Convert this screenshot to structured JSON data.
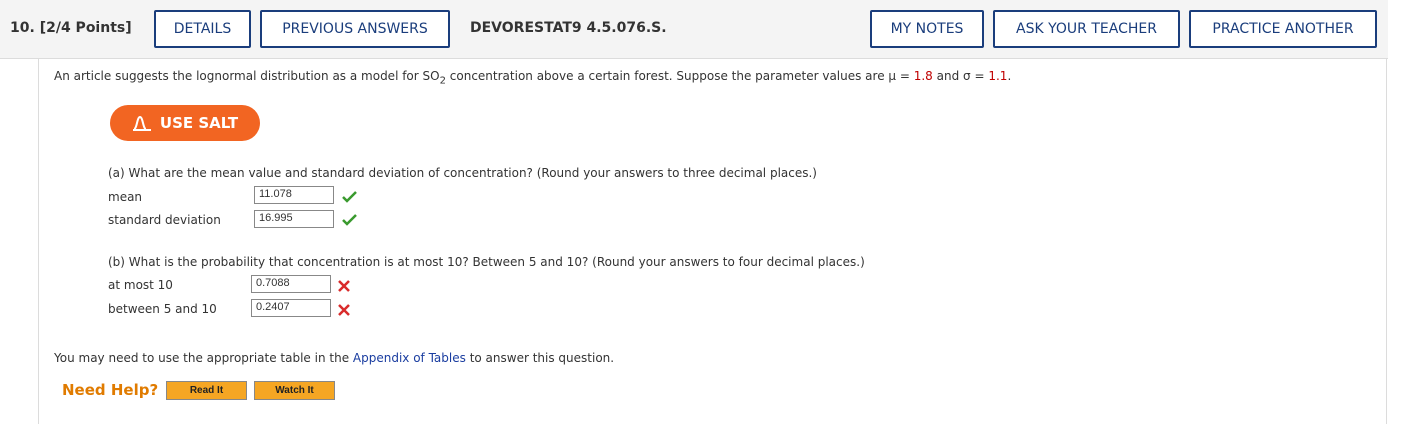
{
  "header": {
    "question_number": "10.",
    "points": "[2/4 Points]",
    "details_label": "DETAILS",
    "previous_answers_label": "PREVIOUS ANSWERS",
    "problem_code": "DEVORESTAT9 4.5.076.S.",
    "my_notes_label": "MY NOTES",
    "ask_teacher_label": "ASK YOUR TEACHER",
    "practice_another_label": "PRACTICE ANOTHER"
  },
  "problem": {
    "intro_before": "An article suggests the lognormal distribution as a model for SO",
    "intro_sub": "2",
    "intro_after": " concentration above a certain forest. Suppose the parameter values are ",
    "mu_symbol": "μ",
    "equals": " = ",
    "mu_value": "1.8",
    "and": " and ",
    "sigma_symbol": "σ",
    "sigma_value": "1.1",
    "period": "."
  },
  "salt_button": {
    "label": "USE SALT"
  },
  "part_a": {
    "question": "(a) What are the mean value and standard deviation of concentration? (Round your answers to three decimal places.)",
    "mean_label": "mean",
    "mean_value": "11.078",
    "sd_label": "standard deviation",
    "sd_value": "16.995"
  },
  "part_b": {
    "question": "(b) What is the probability that concentration is at most 10? Between 5 and 10? (Round your answers to four decimal places.)",
    "at_most_label": "at most 10",
    "at_most_value": "0.7088",
    "between_label": "between 5 and 10",
    "between_value": "0.2407"
  },
  "footer": {
    "appendix_before": "You may need to use the appropriate table in the ",
    "appendix_link": "Appendix of Tables",
    "appendix_after": " to answer this question.",
    "need_help": "Need Help?",
    "read_it": "Read It",
    "watch_it": "Watch It"
  },
  "colors": {
    "accent": "#1a3d7c",
    "salt": "#f26522",
    "correct": "#3a9a2e",
    "incorrect": "#d92b2b",
    "param_red": "#c00000"
  }
}
